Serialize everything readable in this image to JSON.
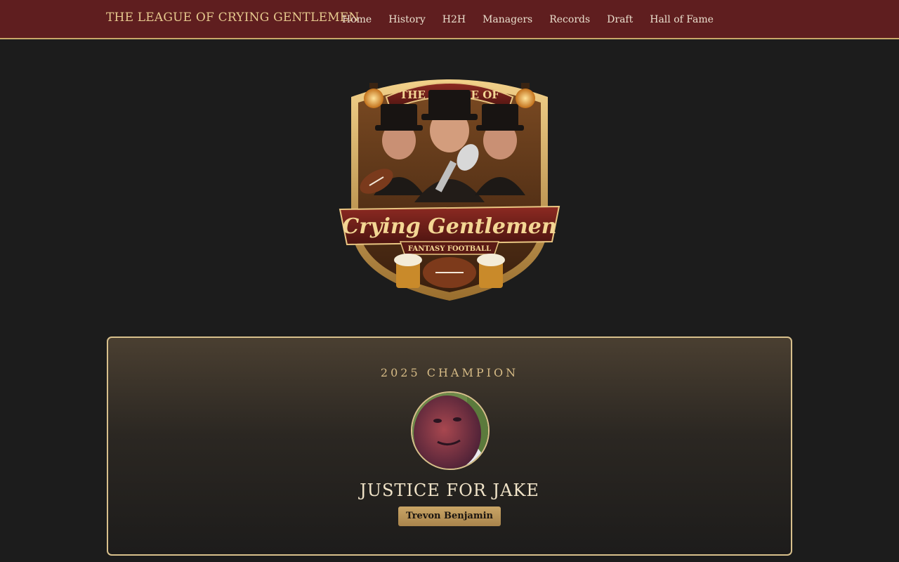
{
  "nav": {
    "brand": "THE LEAGUE OF CRYING GENTLEMEN",
    "links": [
      "Home",
      "History",
      "H2H",
      "Managers",
      "Records",
      "Draft",
      "Hall of Fame"
    ]
  },
  "logo": {
    "icon": "league-crest-logo",
    "text_top": "THE LEAGUE OF",
    "text_main": "Crying Gentlemen",
    "text_sub": "FANTASY FOOTBALL"
  },
  "champion": {
    "label": "2025 CHAMPION",
    "team_name": "JUSTICE FOR JAKE",
    "manager": "Trevon Benjamin"
  },
  "colors": {
    "nav_bg": "#5f1e1f",
    "gold": "#d8c08c",
    "page_bg": "#1c1c1c"
  }
}
